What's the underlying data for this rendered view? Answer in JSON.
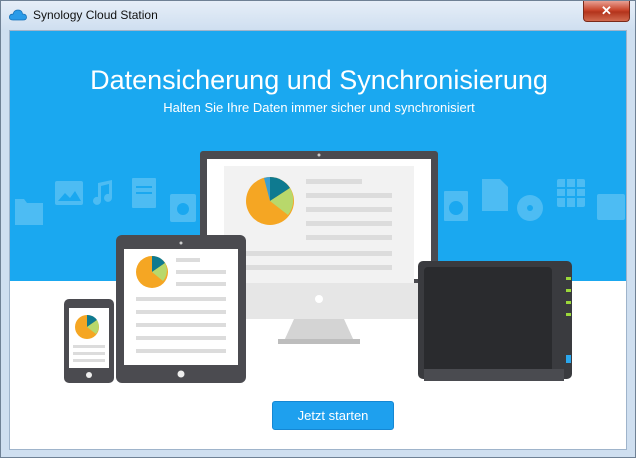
{
  "window": {
    "title": "Synology Cloud Station",
    "close_glyph": "✕",
    "app_icon": "cloud-icon"
  },
  "hero": {
    "headline": "Datensicherung und Synchronisierung",
    "subheadline": "Halten Sie Ihre Daten immer sicher und synchronisiert",
    "background_color": "#1aa8f0"
  },
  "devices": [
    "phone",
    "tablet",
    "desktop-monitor",
    "nas-server"
  ],
  "background_icons": [
    "folder-icon",
    "image-icon",
    "music-icon",
    "document-icon",
    "video-icon",
    "globe-file-icon",
    "pdf-icon",
    "disc-icon",
    "spreadsheet-icon",
    "package-icon"
  ],
  "actions": {
    "start_label": "Jetzt starten"
  }
}
